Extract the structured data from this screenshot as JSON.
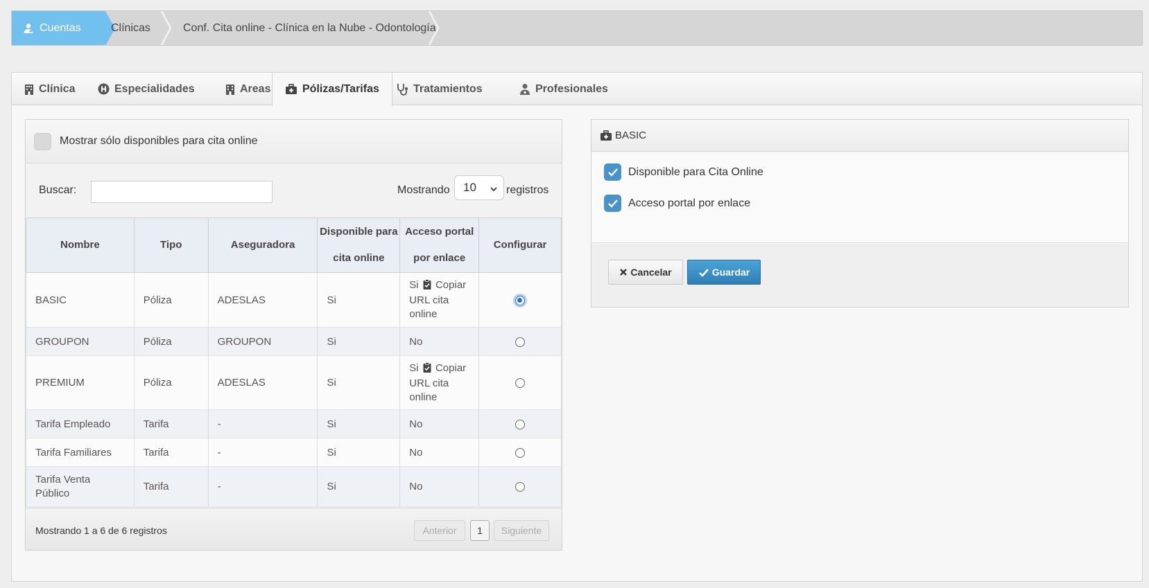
{
  "breadcrumb": {
    "items": [
      "Cuentas",
      "Clínicas",
      "Conf. Cita online - Clínica en la Nube - Odontología"
    ]
  },
  "tabs": [
    {
      "label": "Clínica",
      "icon": "building-icon"
    },
    {
      "label": "Especialidades",
      "icon": "hospital-h-icon"
    },
    {
      "label": "Areas",
      "icon": "building-icon"
    },
    {
      "label": "Pólizas/Tarifas",
      "icon": "medical-kit-icon",
      "active": true
    },
    {
      "label": "Tratamientos",
      "icon": "stethoscope-icon"
    },
    {
      "label": "Profesionales",
      "icon": "doctor-icon"
    }
  ],
  "list_panel": {
    "filter_label": "Mostrar sólo disponibles para cita online",
    "search_label": "Buscar:",
    "search_value": "",
    "show_label": "Mostrando",
    "page_size": "10",
    "records_label": "registros",
    "columns": [
      "Nombre",
      "Tipo",
      "Aseguradora",
      "Disponible para cita online",
      "Acceso portal por enlace",
      "Configurar"
    ],
    "rows": [
      {
        "nombre": "BASIC",
        "tipo": "Póliza",
        "aseguradora": "ADESLAS",
        "disponible": "Si",
        "acceso": "Si",
        "copy_label": "Copiar URL cita online",
        "selected": true
      },
      {
        "nombre": "GROUPON",
        "tipo": "Póliza",
        "aseguradora": "GROUPON",
        "disponible": "Si",
        "acceso": "No",
        "copy_label": "",
        "selected": false
      },
      {
        "nombre": "PREMIUM",
        "tipo": "Póliza",
        "aseguradora": "ADESLAS",
        "disponible": "Si",
        "acceso": "Si",
        "copy_label": "Copiar URL cita online",
        "selected": false
      },
      {
        "nombre": "Tarifa Empleado",
        "tipo": "Tarifa",
        "aseguradora": "-",
        "disponible": "Si",
        "acceso": "No",
        "copy_label": "",
        "selected": false
      },
      {
        "nombre": "Tarifa Familiares",
        "tipo": "Tarifa",
        "aseguradora": "-",
        "disponible": "Si",
        "acceso": "No",
        "copy_label": "",
        "selected": false
      },
      {
        "nombre": "Tarifa Venta Público",
        "tipo": "Tarifa",
        "aseguradora": "-",
        "disponible": "Si",
        "acceso": "No",
        "copy_label": "",
        "selected": false
      }
    ],
    "footer_info": "Mostrando 1 a 6 de 6 registros",
    "pagination": {
      "prev": "Anterior",
      "current": "1",
      "next": "Siguiente"
    }
  },
  "detail_panel": {
    "title": "BASIC",
    "checkbox_available": "Disponible para Cita Online",
    "checkbox_portal": "Acceso portal por enlace",
    "cancel_label": "Cancelar",
    "save_label": "Guardar"
  },
  "colors": {
    "breadcrumb_active": "#72c0ee",
    "primary_button": "#3a8fc6",
    "checkbox": "#4a93c9"
  }
}
